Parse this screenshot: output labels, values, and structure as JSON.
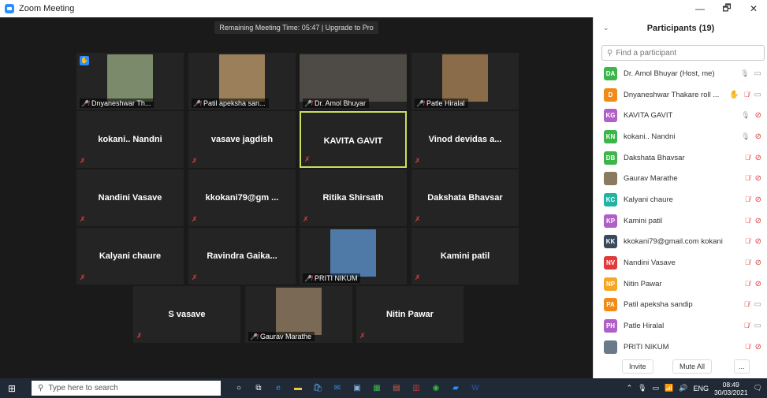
{
  "window": {
    "title": "Zoom Meeting",
    "minimize": "—",
    "restore": "🗗",
    "close": "✕"
  },
  "meeting": {
    "remaining_time": "Remaining Meeting Time: 05:47 | Upgrade to Pro",
    "tiles": [
      {
        "name": "Dnyaneshwar Th...",
        "type": "photo",
        "photo_color": "#7a8a6a",
        "raised_hand": true
      },
      {
        "name": "Patil apeksha san...",
        "type": "photo",
        "photo_color": "#9a7f5a"
      },
      {
        "name": "Dr. Amol Bhuyar",
        "type": "photo",
        "photo_color": "#4e4a45"
      },
      {
        "name": "Patle Hiralal",
        "type": "photo",
        "photo_color": "#8a6b4a"
      },
      {
        "name": "kokani.. Nandni",
        "type": "text"
      },
      {
        "name": "vasave jagdish",
        "type": "text"
      },
      {
        "name": "KAVITA GAVIT",
        "type": "text",
        "active": true
      },
      {
        "name": "Vinod devidas a...",
        "type": "text"
      },
      {
        "name": "Nandini Vasave",
        "type": "text"
      },
      {
        "name": "kkokani79@gm ...",
        "type": "text"
      },
      {
        "name": "Ritika Shirsath",
        "type": "text"
      },
      {
        "name": "Dakshata Bhavsar",
        "type": "text"
      },
      {
        "name": "Kalyani chaure",
        "type": "text"
      },
      {
        "name": "Ravindra Gaika...",
        "type": "text"
      },
      {
        "name": "PRITI NIKUM",
        "type": "photo",
        "photo_color": "#4f7aa8"
      },
      {
        "name": "Kamini patil",
        "type": "text"
      },
      {
        "name": "S vasave",
        "type": "text"
      },
      {
        "name": "Gaurav Marathe",
        "type": "photo",
        "photo_color": "#7a6a55"
      },
      {
        "name": "Nitin Pawar",
        "type": "text"
      }
    ]
  },
  "participants": {
    "title": "Participants (19)",
    "search_placeholder": "Find a participant",
    "list": [
      {
        "initials": "DA",
        "color": "#3cb64b",
        "name": "Dr. Amol Bhuyar (Host, me)",
        "mic": "muted-gray",
        "video": "on"
      },
      {
        "initials": "D",
        "color": "#f28a19",
        "name": "Dnyaneshwar Thakare roll ...",
        "mic": "off",
        "video": "on",
        "hand": true
      },
      {
        "initials": "KG",
        "color": "#b05fc7",
        "name": "KAVITA GAVIT",
        "mic": "muted-gray",
        "video": "off"
      },
      {
        "initials": "KN",
        "color": "#3cb64b",
        "name": "kokani.. Nandni",
        "mic": "muted-gray",
        "video": "off"
      },
      {
        "initials": "DB",
        "color": "#3cb64b",
        "name": "Dakshata Bhavsar",
        "mic": "off",
        "video": "off"
      },
      {
        "initials": "",
        "color": "#8a7a60",
        "name": "Gaurav Marathe",
        "mic": "off",
        "video": "off",
        "photo": true
      },
      {
        "initials": "KC",
        "color": "#22b3a3",
        "name": "Kalyani chaure",
        "mic": "off",
        "video": "off"
      },
      {
        "initials": "KP",
        "color": "#b05fc7",
        "name": "Kamini patil",
        "mic": "off",
        "video": "off"
      },
      {
        "initials": "KK",
        "color": "#3a4a5a",
        "name": "kkokani79@gmail.com kokani",
        "mic": "off",
        "video": "off"
      },
      {
        "initials": "NV",
        "color": "#e03a3a",
        "name": "Nandini Vasave",
        "mic": "off",
        "video": "off"
      },
      {
        "initials": "NP",
        "color": "#f5a623",
        "name": "Nitin Pawar",
        "mic": "off",
        "video": "off"
      },
      {
        "initials": "PA",
        "color": "#f28a19",
        "name": "Patil apeksha sandip",
        "mic": "off",
        "video": "on"
      },
      {
        "initials": "PH",
        "color": "#b05fc7",
        "name": "Patle Hiralal",
        "mic": "off",
        "video": "on"
      },
      {
        "initials": "",
        "color": "#6a7a8a",
        "name": "PRITI NIKUM",
        "mic": "off",
        "video": "off",
        "photo": true
      }
    ],
    "invite_label": "Invite",
    "mute_all_label": "Mute All",
    "more_label": "..."
  },
  "taskbar": {
    "search_placeholder": "Type here to search",
    "lang": "ENG",
    "time": "08:49",
    "date": "30/03/2021"
  }
}
